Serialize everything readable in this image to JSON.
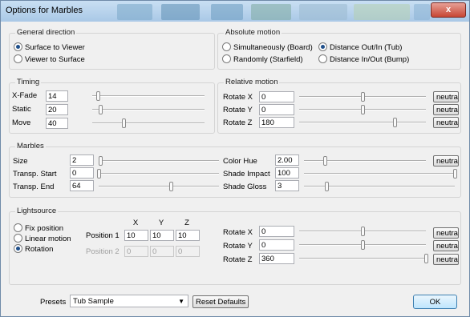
{
  "window": {
    "title": "Options for Marbles",
    "close_symbol": "x"
  },
  "general_direction": {
    "label": "General direction",
    "options": [
      {
        "label": "Surface to Viewer",
        "selected": true
      },
      {
        "label": "Viewer to Surface",
        "selected": false
      }
    ]
  },
  "absolute_motion": {
    "label": "Absolute motion",
    "options": [
      {
        "label": "Simultaneously (Board)",
        "selected": false
      },
      {
        "label": "Distance Out/In (Tub)",
        "selected": true
      },
      {
        "label": "Randomly (Starfield)",
        "selected": false
      },
      {
        "label": "Distance In/Out (Bump)",
        "selected": false
      }
    ]
  },
  "timing": {
    "label": "Timing",
    "rows": [
      {
        "label": "X-Fade",
        "value": "14",
        "level": 0.05
      },
      {
        "label": "Static",
        "value": "20",
        "level": 0.07
      },
      {
        "label": "Move",
        "value": "40",
        "level": 0.28
      }
    ]
  },
  "relative_motion": {
    "label": "Relative motion",
    "rows": [
      {
        "label": "Rotate X",
        "value": "0",
        "level": 0.5
      },
      {
        "label": "Rotate Y",
        "value": "0",
        "level": 0.5
      },
      {
        "label": "Rotate Z",
        "value": "180",
        "level": 0.75
      }
    ]
  },
  "marbles": {
    "label": "Marbles",
    "left_rows": [
      {
        "label": "Size",
        "value": "2",
        "level": 0.01
      },
      {
        "label": "Transp. Start",
        "value": "0",
        "level": 0.0
      },
      {
        "label": "Transp. End",
        "value": "64",
        "level": 0.6
      }
    ],
    "right_rows": [
      {
        "label": "Color Hue",
        "value": "2.00",
        "level": 0.17
      },
      {
        "label": "Shade Impact",
        "value": "100",
        "level": 1.0
      },
      {
        "label": "Shade Gloss",
        "value": "3",
        "level": 0.15
      }
    ]
  },
  "lightsource": {
    "label": "Lightsource",
    "options": [
      {
        "label": "Fix position",
        "selected": false
      },
      {
        "label": "Linear motion",
        "selected": false
      },
      {
        "label": "Rotation",
        "selected": true
      }
    ],
    "axis_headers": [
      "X",
      "Y",
      "Z"
    ],
    "position1": {
      "label": "Position 1",
      "values": [
        "10",
        "10",
        "10"
      ]
    },
    "position2": {
      "label": "Position 2",
      "values": [
        "0",
        "0",
        "0"
      ]
    },
    "rows": [
      {
        "label": "Rotate X",
        "value": "0",
        "level": 0.5
      },
      {
        "label": "Rotate Y",
        "value": "0",
        "level": 0.5
      },
      {
        "label": "Rotate Z",
        "value": "360",
        "level": 1.0
      }
    ]
  },
  "neutral_label": "neutra",
  "presets": {
    "label": "Presets",
    "selected": "Tub Sample"
  },
  "reset_label": "Reset Defaults",
  "ok_label": "OK"
}
